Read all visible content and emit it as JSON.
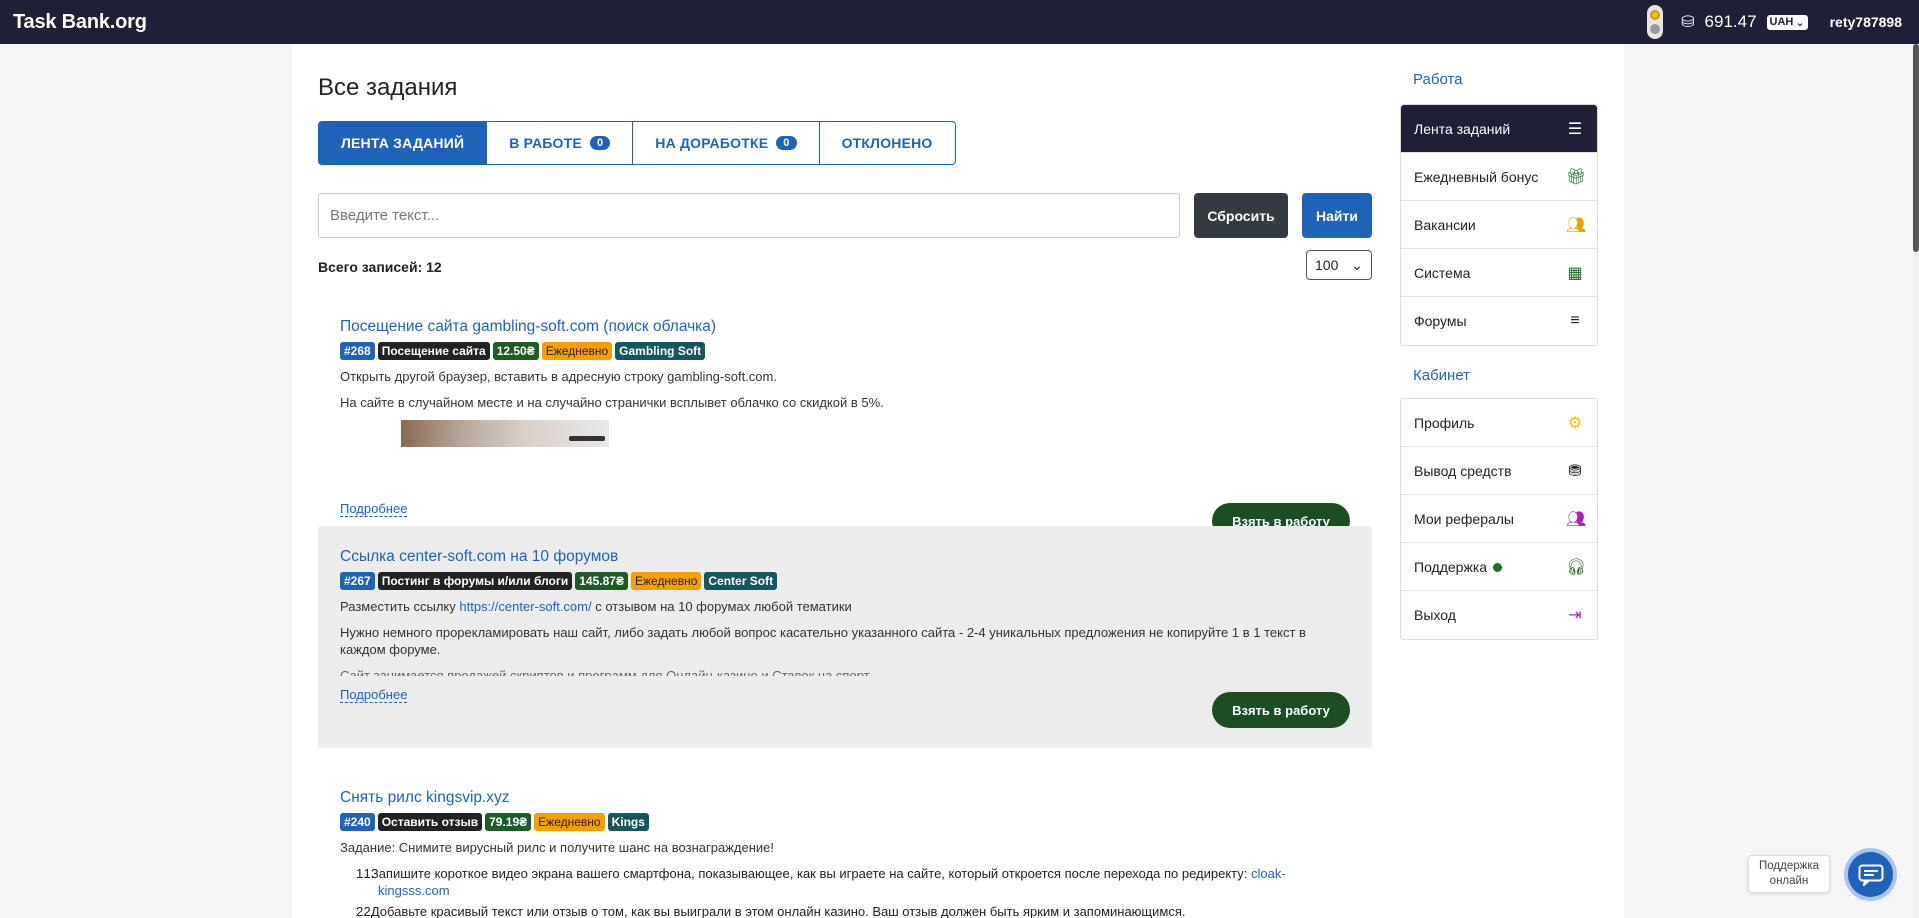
{
  "header": {
    "logo": "Task Bank.org",
    "balance": "691.47",
    "currency": "UAH",
    "username": "rety787898"
  },
  "page": {
    "title": "Все задания",
    "tabs": [
      {
        "label": "ЛЕНТА ЗАДАНИЙ",
        "count": null
      },
      {
        "label": "В РАБОТЕ",
        "count": "0"
      },
      {
        "label": "НА ДОРАБОТКЕ",
        "count": "0"
      },
      {
        "label": "ОТКЛОНЕНО",
        "count": null
      }
    ],
    "search_placeholder": "Введите текст...",
    "reset_label": "Сбросить",
    "find_label": "Найти",
    "total_label": "Всего записей: 12",
    "per_page": "100"
  },
  "tasks": [
    {
      "title": "Посещение сайта gambling-soft.com (поиск облачка)",
      "id": "#268",
      "type": "Посещение сайта",
      "price": "12.50₴",
      "freq": "Ежедневно",
      "brand": "Gambling Soft",
      "desc1": "Открыть другой браузер, вставить в адресную строку gambling-soft.com.",
      "desc2": "На сайте в случайном месте и на случайно странички всплывет облачко со скидкой в 5%.",
      "more": "Подробнее",
      "take": "Взять в работу"
    },
    {
      "title": "Ссылка center-soft.com на 10 форумов",
      "id": "#267",
      "type": "Постинг в форумы и/или блоги",
      "price": "145.87₴",
      "freq": "Ежедневно",
      "brand": "Center Soft",
      "desc1_pre": "Разместить ссылку ",
      "desc1_link": "https://center-soft.com/",
      "desc1_post": " с отзывом на 10 форумах любой тематики",
      "desc2": "Нужно немного прорекламировать наш сайт, либо задать любой вопрос касательно указанного сайта - 2-4 уникальных предложения не копируйте 1 в 1 текст в каждом форуме.",
      "desc3": "Сайт занимается продажей скриптов и программ для Онлайн-казино и Ставок на спорт",
      "more": "Подробнее",
      "take": "Взять в работу"
    },
    {
      "title": "Снять рилс kingsvip.xyz",
      "id": "#240",
      "type": "Оставить отзыв",
      "price": "79.19₴",
      "freq": "Ежедневно",
      "brand": "Kings",
      "desc1": "Задание: Снимите вирусный рилс и получите шанс на вознаграждение!",
      "step1_num": "1.",
      "step1": "Запишите короткое видео экрана вашего смартфона, показывающее, как вы играете на сайте, который откроется после перехода по редиректу: ",
      "step1_link": "cloak-kingsss.com",
      "step2_num": "2.",
      "step2": "Добавьте красивый текст или отзыв о том, как вы выиграли в этом онлайн казино. Ваш отзыв должен быть ярким и запоминающимся."
    }
  ],
  "sidebar": {
    "work_title": "Работа",
    "work_items": [
      {
        "label": "Лента заданий",
        "icon": "list-check-icon"
      },
      {
        "label": "Ежедневный бонус",
        "icon": "gift-icon"
      },
      {
        "label": "Вакансии",
        "icon": "users-icon"
      },
      {
        "label": "Система",
        "icon": "table-icon"
      },
      {
        "label": "Форумы",
        "icon": "align-left-icon"
      }
    ],
    "cabinet_title": "Кабинет",
    "cabinet_items": [
      {
        "label": "Профиль",
        "icon": "gear-icon"
      },
      {
        "label": "Вывод средств",
        "icon": "money-icon"
      },
      {
        "label": "Мои рефералы",
        "icon": "users-icon"
      },
      {
        "label": "Поддержка",
        "icon": "headset-icon"
      },
      {
        "label": "Выход",
        "icon": "logout-icon"
      }
    ]
  },
  "support_widget": {
    "line1": "Поддержка",
    "line2": "онлайн"
  },
  "colors": {
    "header_bg": "#1f1f35",
    "accent": "#1f63b8",
    "take_button": "#1b4f22"
  }
}
